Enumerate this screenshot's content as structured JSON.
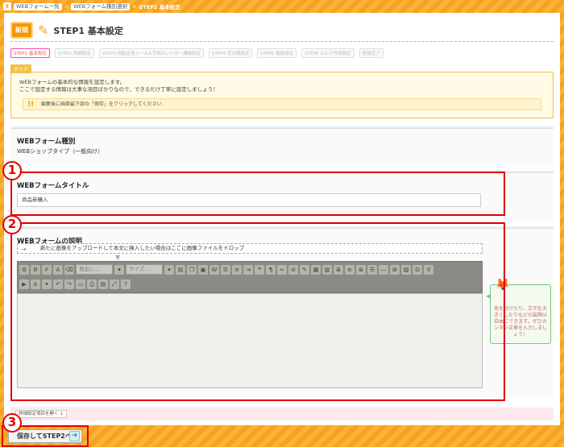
{
  "breadcrumb": {
    "home": "t",
    "items": [
      "WEBフォーム一覧",
      "WEBフォーム種別選択"
    ],
    "current": "STEP1 基本設定"
  },
  "header": {
    "new_badge": "新規",
    "title": "STEP1 基本設定"
  },
  "steps": [
    "STEP1 基本設定",
    "STEP2 詳細設定",
    "STEP3 自動返信メール&手続のレンダー通帳設定",
    "STEP4 受付期設定",
    "STEP5 機能設定",
    "STEP6 カルテ作成設定",
    "登録完了"
  ],
  "guide": {
    "tag": "ガイド",
    "line1": "WEBフォームの基本的な情報を設定します。",
    "line2": "ここで設定する情報は大事な項目ばかりなので、できるだけ丁寧に設定しましょう！",
    "note": "編集後に画面最下部の「保存」をクリックしてください"
  },
  "form_type": {
    "label": "WEBフォーム種別",
    "value": "WEBショップタイプ（一般向け）"
  },
  "form_title": {
    "label": "WEBフォームタイトル",
    "value": "商品券購入"
  },
  "description": {
    "label": "WEBフォームの説明",
    "drop_text": "新たに画像をアップロードして本文に挿入したい場合はここに画像ファイルをドロップ",
    "style_select": "見出し...",
    "size_select": "サイズ...",
    "hint": "色を付けたり、文字を大きくしたりなどの装飾は自由にできます。ぜひカンタン文章を入力しましょう！"
  },
  "detail_button": "詳細設定項目を開く ↓",
  "save_button": "保存してSTEP2へ",
  "annotations": [
    "1",
    "2",
    "3"
  ]
}
